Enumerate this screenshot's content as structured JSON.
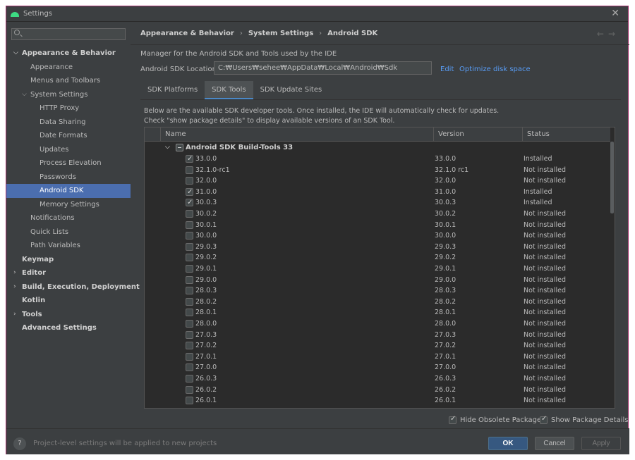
{
  "window": {
    "title": "Settings"
  },
  "search": {
    "placeholder": "",
    "value": ""
  },
  "sidebar": {
    "items": [
      {
        "label": "Appearance & Behavior",
        "level": 0,
        "bold": true,
        "expandable": true,
        "expanded": true
      },
      {
        "label": "Appearance",
        "level": 2
      },
      {
        "label": "Menus and Toolbars",
        "level": 2
      },
      {
        "label": "System Settings",
        "level": 1,
        "expandable": true,
        "expanded": true
      },
      {
        "label": "HTTP Proxy",
        "level": 3
      },
      {
        "label": "Data Sharing",
        "level": 3
      },
      {
        "label": "Date Formats",
        "level": 3
      },
      {
        "label": "Updates",
        "level": 3
      },
      {
        "label": "Process Elevation",
        "level": 3
      },
      {
        "label": "Passwords",
        "level": 3
      },
      {
        "label": "Android SDK",
        "level": 3,
        "selected": true
      },
      {
        "label": "Memory Settings",
        "level": 3
      },
      {
        "label": "Notifications",
        "level": 2
      },
      {
        "label": "Quick Lists",
        "level": 2
      },
      {
        "label": "Path Variables",
        "level": 2
      },
      {
        "label": "Keymap",
        "level": 0,
        "bold": true
      },
      {
        "label": "Editor",
        "level": 0,
        "bold": true,
        "expandable": true,
        "expanded": false
      },
      {
        "label": "Build, Execution, Deployment",
        "level": 0,
        "bold": true,
        "expandable": true,
        "expanded": false
      },
      {
        "label": "Kotlin",
        "level": 0,
        "bold": true
      },
      {
        "label": "Tools",
        "level": 0,
        "bold": true,
        "expandable": true,
        "expanded": false
      },
      {
        "label": "Advanced Settings",
        "level": 0,
        "bold": true
      }
    ]
  },
  "breadcrumb": {
    "items": [
      "Appearance & Behavior",
      "System Settings",
      "Android SDK"
    ]
  },
  "main": {
    "description": "Manager for the Android SDK and Tools used by the IDE",
    "sdk_location_label": "Android SDK Location:",
    "sdk_location_value": "C:₩Users₩sehee₩AppData₩Local₩Android₩Sdk",
    "edit_link": "Edit",
    "optimize_link": "Optimize disk space",
    "tabs": [
      "SDK Platforms",
      "SDK Tools",
      "SDK Update Sites"
    ],
    "active_tab": 1,
    "info_line1": "Below are the available SDK developer tools. Once installed, the IDE will automatically check for updates.",
    "info_line2": "Check \"show package details\" to display available versions of an SDK Tool.",
    "table": {
      "columns": [
        "Name",
        "Version",
        "Status"
      ],
      "group": "Android SDK Build-Tools 33",
      "rows": [
        {
          "name": "33.0.0",
          "version": "33.0.0",
          "status": "Installed",
          "checked": true
        },
        {
          "name": "32.1.0-rc1",
          "version": "32.1.0 rc1",
          "status": "Not installed",
          "checked": false
        },
        {
          "name": "32.0.0",
          "version": "32.0.0",
          "status": "Not installed",
          "checked": false
        },
        {
          "name": "31.0.0",
          "version": "31.0.0",
          "status": "Installed",
          "checked": true
        },
        {
          "name": "30.0.3",
          "version": "30.0.3",
          "status": "Installed",
          "checked": true
        },
        {
          "name": "30.0.2",
          "version": "30.0.2",
          "status": "Not installed",
          "checked": false
        },
        {
          "name": "30.0.1",
          "version": "30.0.1",
          "status": "Not installed",
          "checked": false
        },
        {
          "name": "30.0.0",
          "version": "30.0.0",
          "status": "Not installed",
          "checked": false
        },
        {
          "name": "29.0.3",
          "version": "29.0.3",
          "status": "Not installed",
          "checked": false
        },
        {
          "name": "29.0.2",
          "version": "29.0.2",
          "status": "Not installed",
          "checked": false
        },
        {
          "name": "29.0.1",
          "version": "29.0.1",
          "status": "Not installed",
          "checked": false
        },
        {
          "name": "29.0.0",
          "version": "29.0.0",
          "status": "Not installed",
          "checked": false
        },
        {
          "name": "28.0.3",
          "version": "28.0.3",
          "status": "Not installed",
          "checked": false
        },
        {
          "name": "28.0.2",
          "version": "28.0.2",
          "status": "Not installed",
          "checked": false
        },
        {
          "name": "28.0.1",
          "version": "28.0.1",
          "status": "Not installed",
          "checked": false
        },
        {
          "name": "28.0.0",
          "version": "28.0.0",
          "status": "Not installed",
          "checked": false
        },
        {
          "name": "27.0.3",
          "version": "27.0.3",
          "status": "Not installed",
          "checked": false
        },
        {
          "name": "27.0.2",
          "version": "27.0.2",
          "status": "Not installed",
          "checked": false
        },
        {
          "name": "27.0.1",
          "version": "27.0.1",
          "status": "Not installed",
          "checked": false
        },
        {
          "name": "27.0.0",
          "version": "27.0.0",
          "status": "Not installed",
          "checked": false
        },
        {
          "name": "26.0.3",
          "version": "26.0.3",
          "status": "Not installed",
          "checked": false
        },
        {
          "name": "26.0.2",
          "version": "26.0.2",
          "status": "Not installed",
          "checked": false
        },
        {
          "name": "26.0.1",
          "version": "26.0.1",
          "status": "Not installed",
          "checked": false
        }
      ]
    },
    "hide_obsolete_label": "Hide Obsolete Packages",
    "hide_obsolete_checked": true,
    "show_details_label": "Show Package Details",
    "show_details_checked": true
  },
  "footer": {
    "help_label": "?",
    "note": "Project-level settings will be applied to new projects",
    "ok_label": "OK",
    "cancel_label": "Cancel",
    "apply_label": "Apply"
  },
  "colors": {
    "background": "#3c3f41",
    "table_background": "#2b2b2b",
    "selection": "#4b6eaf",
    "link": "#589df6",
    "primary_button": "#365880",
    "window_border": "#a3306c",
    "android_green": "#3ddc84"
  }
}
